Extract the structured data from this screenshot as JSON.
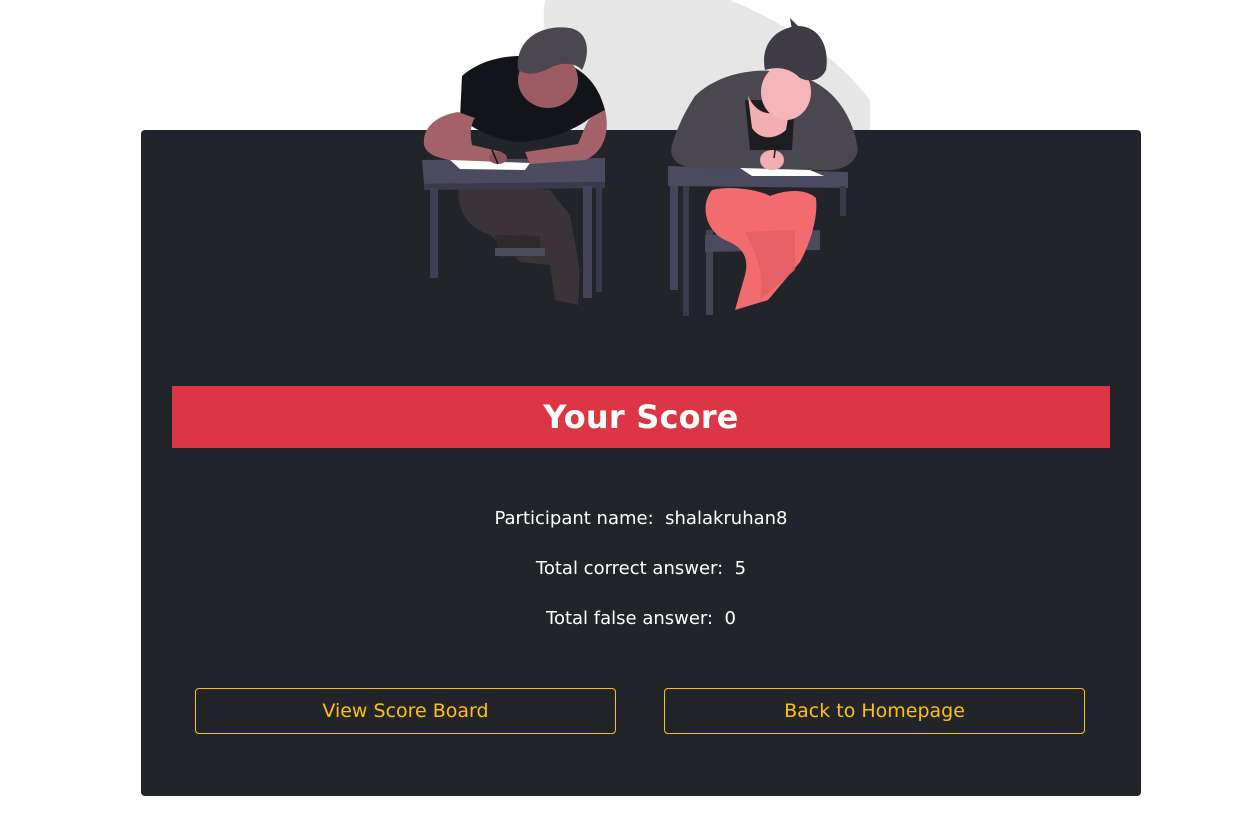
{
  "banner": {
    "title": "Your Score"
  },
  "stats": {
    "participant_label": "Participant name:",
    "participant_value": "shalakruhan8",
    "correct_label": "Total correct answer:",
    "correct_value": "5",
    "false_label": "Total false answer:",
    "false_value": "0"
  },
  "actions": {
    "view_scoreboard": "View Score Board",
    "back_home": "Back to Homepage"
  },
  "theme": {
    "card_bg": "#212428",
    "banner_bg": "#dc3545",
    "button_accent": "#ffc107",
    "blob_gray": "#e6e6e6"
  },
  "icons": {
    "illustration": "students-taking-exam-illustration"
  }
}
